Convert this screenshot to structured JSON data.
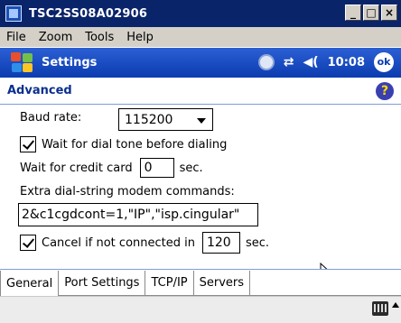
{
  "window": {
    "title": "TSC2SS08A02906",
    "minimize_label": "_",
    "restore_label": "□",
    "close_label": "×"
  },
  "menu": {
    "items": [
      "File",
      "Zoom",
      "Tools",
      "Help"
    ]
  },
  "ppc_bar": {
    "title": "Settings",
    "time": "10:08",
    "ok_label": "ok",
    "start_icon": "windows-flag-icon",
    "sync_icon": "sync-icon",
    "connectivity_icon": "connectivity-icon",
    "volume_icon": "speaker-icon"
  },
  "page": {
    "title": "Advanced",
    "help_label": "?"
  },
  "form": {
    "baud_rate": {
      "label": "Baud rate:",
      "value": "115200"
    },
    "wait_dial_tone": {
      "label": "Wait for dial tone before dialing",
      "checked": true
    },
    "wait_credit_card": {
      "label": "Wait for credit card",
      "value": "0",
      "unit": "sec."
    },
    "extra_commands": {
      "label": "Extra dial-string modem commands:",
      "value": "2&c1cgdcont=1,\"IP\",\"isp.cingular\""
    },
    "cancel_not_connected": {
      "label": "Cancel if not connected in",
      "value": "120",
      "unit": "sec.",
      "checked": true
    }
  },
  "tabs": [
    {
      "label": "General",
      "active": true
    },
    {
      "label": "Port Settings",
      "active": false
    },
    {
      "label": "TCP/IP",
      "active": false
    },
    {
      "label": "Servers",
      "active": false
    }
  ],
  "bottom": {
    "keyboard_icon": "keyboard-icon",
    "up_icon": "up-arrow-icon"
  },
  "colors": {
    "titlebar": "#0a246a",
    "ppc_bar": "#0b3cb0",
    "accent": "#0b2f8e"
  }
}
